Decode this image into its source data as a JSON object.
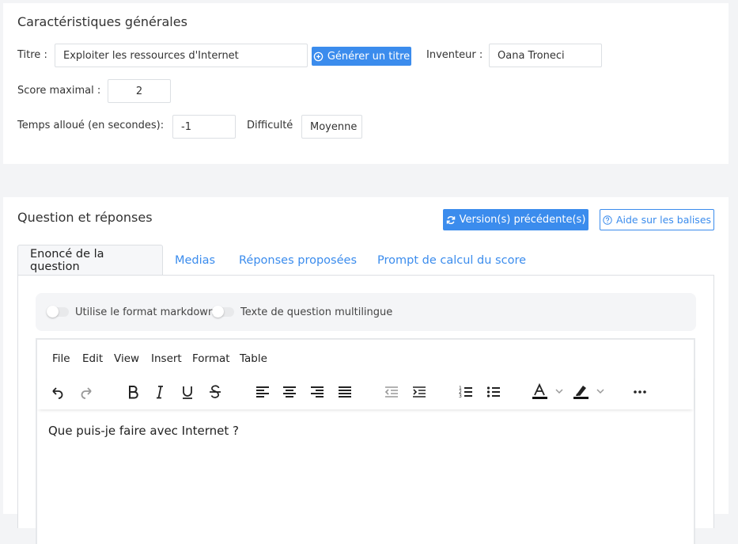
{
  "general": {
    "title": "Caractéristiques générales",
    "titre_label": "Titre :",
    "titre_value": "Exploiter les ressources d'Internet",
    "generate_title_label": "Générer un titre",
    "inventeur_label": "Inventeur :",
    "inventeur_value": "Oana Troneci",
    "score_label": "Score maximal :",
    "score_value": "2",
    "temps_label": "Temps alloué (en secondes):",
    "temps_value": "-1",
    "difficulte_label": "Difficulté",
    "difficulte_value": "Moyenne"
  },
  "qa": {
    "title": "Question et réponses",
    "versions_label": "Version(s) précédente(s)",
    "help_label": "Aide sur les balises",
    "tabs": [
      {
        "label": "Enoncé de la question",
        "active": true
      },
      {
        "label": "Medias",
        "active": false
      },
      {
        "label": "Réponses proposées",
        "active": false
      },
      {
        "label": "Prompt de calcul du score",
        "active": false
      }
    ],
    "toggle_markdown_label": "Utilise le format markdown",
    "toggle_multilingual_label": "Texte de question multilingue"
  },
  "editor": {
    "menu": [
      "File",
      "Edit",
      "View",
      "Insert",
      "Format",
      "Table"
    ],
    "toolbar_icons": [
      "undo-icon",
      "redo-icon",
      "bold-icon",
      "italic-icon",
      "underline-icon",
      "strikethrough-icon",
      "align-left-icon",
      "align-center-icon",
      "align-right-icon",
      "align-justify-icon",
      "outdent-icon",
      "indent-icon",
      "numbered-list-icon",
      "bullet-list-icon",
      "text-color-icon",
      "highlight-color-icon",
      "more-icon"
    ],
    "content": "Que puis-je faire avec Internet ?"
  },
  "colors": {
    "accent": "#3b8ced",
    "background": "#f3f4f6"
  }
}
